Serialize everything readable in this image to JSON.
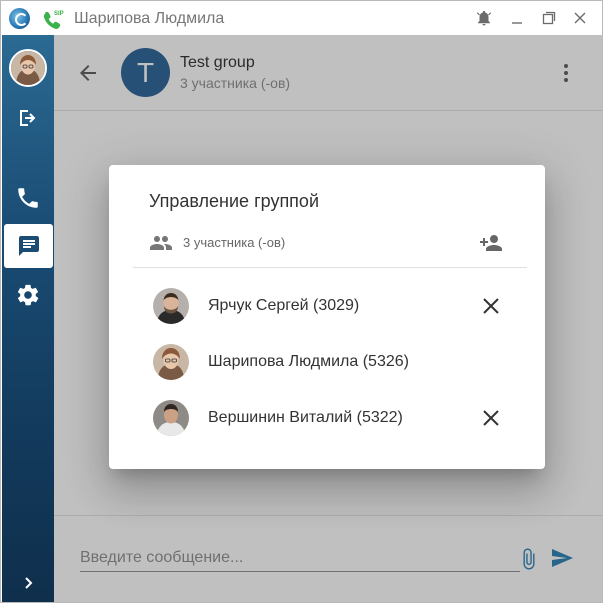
{
  "window": {
    "title": "Шарипова Людмила",
    "sip_badge": "SIP"
  },
  "sidebar": {
    "items": [
      {
        "name": "profile-avatar"
      },
      {
        "name": "logout"
      },
      {
        "name": "calls"
      },
      {
        "name": "chats",
        "active": true
      },
      {
        "name": "settings"
      },
      {
        "name": "expand"
      }
    ]
  },
  "chat": {
    "avatar_letter": "T",
    "title": "Test group",
    "subtitle": "3 участника (-ов)",
    "input_placeholder": "Введите сообщение..."
  },
  "dialog": {
    "title": "Управление группой",
    "count_label": "3 участника (-ов)",
    "members": [
      {
        "name": "Ярчук Сергей (3029)",
        "removable": true
      },
      {
        "name": "Шарипова Людмила (5326)",
        "removable": false
      },
      {
        "name": "Вершинин Виталий (5322)",
        "removable": true
      }
    ]
  },
  "colors": {
    "accent": "#1e5a92",
    "sidebar_top": "#2b6a93",
    "sidebar_bottom": "#0f2f4c",
    "sip_green": "#3bb24a",
    "send_blue": "#1f7ab0"
  }
}
